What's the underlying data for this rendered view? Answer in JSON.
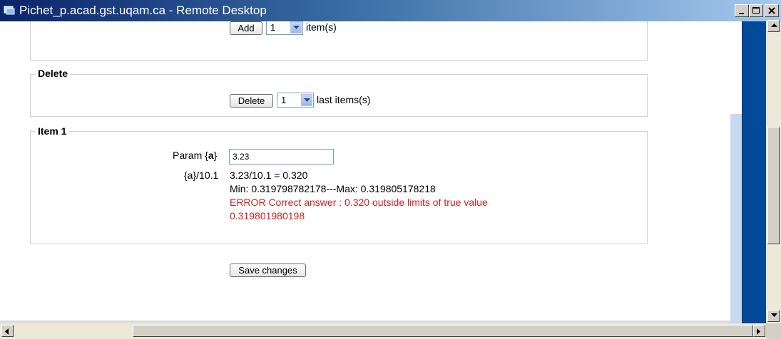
{
  "window": {
    "title": "Pichet_p.acad.gst.uqam.ca - Remote Desktop",
    "controls": [
      "minimize",
      "maximize",
      "close"
    ]
  },
  "add_section": {
    "button_label": "Add",
    "count_value": "1",
    "suffix": "item(s)"
  },
  "delete_section": {
    "legend": "Delete",
    "button_label": "Delete",
    "count_value": "1",
    "suffix": "last items(s)"
  },
  "item1": {
    "legend": "Item 1",
    "param_label_prefix": "Param {",
    "param_name": "a",
    "param_label_suffix": "}",
    "param_value": "3.23",
    "formula_label": "{a}/10.1",
    "result_line": "3.23/10.1 = 0.320",
    "range_line": "Min: 0.319798782178---Max: 0.319805178218",
    "error_line1": "ERROR Correct answer : 0.320 outside limits of true value",
    "error_line2": "0.319801980198"
  },
  "save_button_label": "Save changes",
  "colors": {
    "error": "#cc2222",
    "title_bar_start": "#0a246a",
    "side_panel": "#004a99"
  }
}
